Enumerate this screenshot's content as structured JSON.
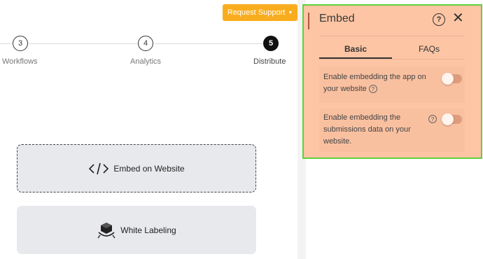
{
  "header": {
    "support_button": "Request Support"
  },
  "steps": [
    {
      "number": "3",
      "label": "Workflows"
    },
    {
      "number": "4",
      "label": "Analytics"
    },
    {
      "number": "5",
      "label": "Distribute",
      "active": true
    }
  ],
  "cards": {
    "embed": "Embed on Website",
    "white_label": "White Labeling"
  },
  "panel": {
    "title": "Embed",
    "tabs": [
      "Basic",
      "FAQs"
    ],
    "active_tab": "Basic",
    "options": [
      {
        "line1": "Enable embedding the app on",
        "line2": "your website",
        "enabled": false
      },
      {
        "line1": "Enable embedding the",
        "line2": "submissions data on your",
        "line3": "website.",
        "enabled": false
      }
    ]
  },
  "colors": {
    "accent": "#f9ad1e",
    "panel_bg": "#fdc5a4",
    "panel_outline": "#5fd13b",
    "card_bg": "#e8e9ec"
  }
}
